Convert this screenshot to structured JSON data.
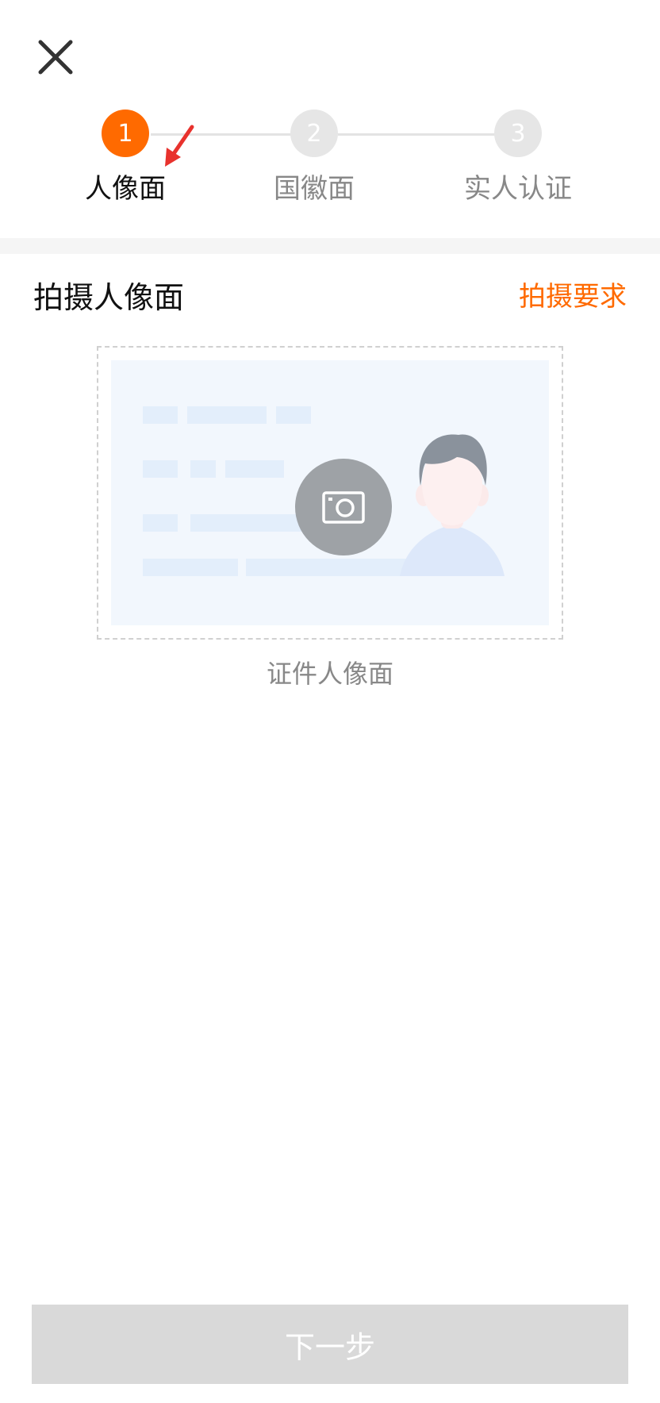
{
  "header": {
    "close_icon": "close-icon"
  },
  "stepper": {
    "steps": [
      {
        "number": "1",
        "label": "人像面"
      },
      {
        "number": "2",
        "label": "国徽面"
      },
      {
        "number": "3",
        "label": "实人认证"
      }
    ],
    "active_index": 0
  },
  "section": {
    "title": "拍摄人像面",
    "requirements_link": "拍摄要求"
  },
  "upload": {
    "caption": "证件人像面",
    "camera_icon": "camera-icon"
  },
  "footer": {
    "next_button": "下一步"
  },
  "colors": {
    "accent": "#ff6a00",
    "disabled_button": "#d9d9d9",
    "inactive_step": "#e6e6e6"
  }
}
